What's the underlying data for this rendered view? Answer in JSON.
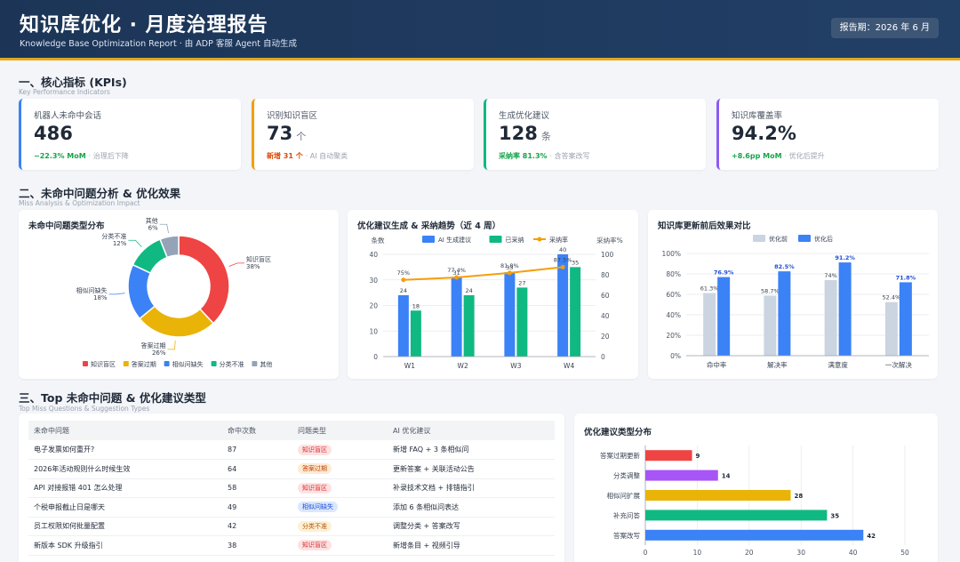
{
  "header": {
    "title": "知识库优化 · 月度治理报告",
    "subtitle": "Knowledge Base Optimization Report · 由 ADP 客服 Agent 自动生成",
    "period": "报告期：2026 年 6 月"
  },
  "sections": {
    "s1_title": "一、核心指标 (KPIs)",
    "s1_sub": "Key Performance Indicators",
    "s2_title": "二、未命中问题分析 & 优化效果",
    "s2_sub": "Miss Analysis & Optimization Impact",
    "s3_title": "三、Top 未命中问题 & 优化建议类型",
    "s3_sub": "Top Miss Questions & Suggestion Types"
  },
  "kpis": [
    {
      "label": "机器人未命中会话",
      "value": "486",
      "unit": "",
      "delta": "−22.3% MoM",
      "note": "· 治理后下降",
      "delta_color": "#16a34a",
      "accent": "#3b82f6"
    },
    {
      "label": "识别知识盲区",
      "value": "73",
      "unit": "个",
      "delta": "新增 31 个",
      "note": "· AI 自动聚类",
      "delta_color": "#dc4a0c",
      "accent": "#f59e0b"
    },
    {
      "label": "生成优化建议",
      "value": "128",
      "unit": "条",
      "delta": "采纳率 81.3%",
      "note": "· 含答案改写",
      "delta_color": "#16a34a",
      "accent": "#10b981"
    },
    {
      "label": "知识库覆盖率",
      "value": "94.2%",
      "unit": "",
      "delta": "+8.6pp MoM",
      "note": "· 优化后提升",
      "delta_color": "#16a34a",
      "accent": "#8b5cf6"
    }
  ],
  "panels": {
    "donut_title": "未命中问题类型分布",
    "trend_title": "优化建议生成 & 采纳趋势（近 4 周）",
    "compare_title": "知识库更新前后效果对比",
    "hbar_title": "优化建议类型分布"
  },
  "chart_data": [
    {
      "type": "pie",
      "title": "未命中问题类型分布",
      "categories": [
        "知识盲区",
        "答案过期",
        "相似问缺失",
        "分类不准",
        "其他"
      ],
      "values": [
        38,
        26,
        18,
        12,
        6
      ],
      "slice_labels": [
        "知识盲区\n38%",
        "答案过期\n26%",
        "相似问缺失\n18%",
        "分类不准\n12%",
        "其他\n6%"
      ],
      "colors": [
        "#ef4444",
        "#eab308",
        "#3b82f6",
        "#10b981",
        "#94a3b8"
      ],
      "legend": "bottom"
    },
    {
      "type": "bar",
      "title": "优化建议生成 & 采纳趋势（近 4 周）",
      "categories": [
        "W1",
        "W2",
        "W3",
        "W4"
      ],
      "series": [
        {
          "name": "AI 生成建议",
          "values": [
            24,
            31,
            33,
            40
          ],
          "color": "#3b82f6"
        },
        {
          "name": "已采纳",
          "values": [
            18,
            24,
            27,
            35
          ],
          "color": "#10b981"
        }
      ],
      "line_series": {
        "name": "采纳率",
        "values": [
          75,
          77.4,
          81.8,
          87.5
        ],
        "labels": [
          "75%",
          "77.4%",
          "81.8%",
          "87.5%"
        ],
        "color": "#f59e0b"
      },
      "ylabel": "条数",
      "y2label": "采纳率%",
      "ylim": [
        0,
        40
      ],
      "y2lim": [
        0,
        100
      ],
      "yticks": [
        "0",
        "10",
        "20",
        "30",
        "40"
      ],
      "y2ticks": [
        "0",
        "20",
        "40",
        "60",
        "80",
        "100"
      ],
      "grid": true,
      "legend": "top"
    },
    {
      "type": "bar",
      "title": "知识库更新前后效果对比",
      "categories": [
        "命中率",
        "解决率",
        "满意度",
        "一次解决"
      ],
      "series": [
        {
          "name": "优化前",
          "values": [
            61.3,
            58.7,
            74,
            52.4
          ],
          "labels": [
            "61.3%",
            "58.7%",
            "74%",
            "52.4%"
          ],
          "color": "#cbd5e1"
        },
        {
          "name": "优化后",
          "values": [
            76.9,
            82.5,
            91.2,
            71.8
          ],
          "labels": [
            "76.9%",
            "82.5%",
            "91.2%",
            "71.8%"
          ],
          "color": "#3b82f6"
        }
      ],
      "ylim": [
        0,
        100
      ],
      "yticks": [
        "0%",
        "20%",
        "40%",
        "60%",
        "80%",
        "100%"
      ],
      "grid": true,
      "legend": "top"
    },
    {
      "type": "bar",
      "orientation": "horizontal",
      "title": "优化建议类型分布",
      "categories": [
        "答案过期更新",
        "分类调整",
        "相似问扩展",
        "补充问答",
        "答案改写"
      ],
      "values": [
        9,
        14,
        28,
        35,
        42
      ],
      "colors": [
        "#ef4444",
        "#a855f7",
        "#eab308",
        "#10b981",
        "#3b82f6"
      ],
      "xlim": [
        0,
        50
      ],
      "xticks": [
        "0",
        "10",
        "20",
        "30",
        "40",
        "50"
      ],
      "grid": true
    }
  ],
  "table": {
    "headers": [
      "未命中问题",
      "命中次数",
      "问题类型",
      "AI 优化建议"
    ],
    "rows": [
      {
        "q": "电子发票如何重开?",
        "hits": "87",
        "type": "知识盲区",
        "type_color": "#fde2e2",
        "type_text": "#dc2626",
        "suggest": "新增 FAQ + 3 条相似问"
      },
      {
        "q": "2026年活动规则什么时候生效",
        "hits": "64",
        "type": "答案过期",
        "type_color": "#fdebd3",
        "type_text": "#c2410c",
        "suggest": "更新答案 + 关联活动公告"
      },
      {
        "q": "API 对接报错 401 怎么处理",
        "hits": "58",
        "type": "知识盲区",
        "type_color": "#fde2e2",
        "type_text": "#dc2626",
        "suggest": "补录技术文档 + 排错指引"
      },
      {
        "q": "个税申报截止日是哪天",
        "hits": "49",
        "type": "相似问缺失",
        "type_color": "#dbe7fd",
        "type_text": "#1d4ed8",
        "suggest": "添加 6 条相似问表达"
      },
      {
        "q": "员工权限如何批量配置",
        "hits": "42",
        "type": "分类不准",
        "type_color": "#fdf0d3",
        "type_text": "#b45309",
        "suggest": "调整分类 + 答案改写"
      },
      {
        "q": "新版本 SDK 升级指引",
        "hits": "38",
        "type": "知识盲区",
        "type_color": "#fde2e2",
        "type_text": "#dc2626",
        "suggest": "新增条目 + 视频引导"
      }
    ]
  }
}
